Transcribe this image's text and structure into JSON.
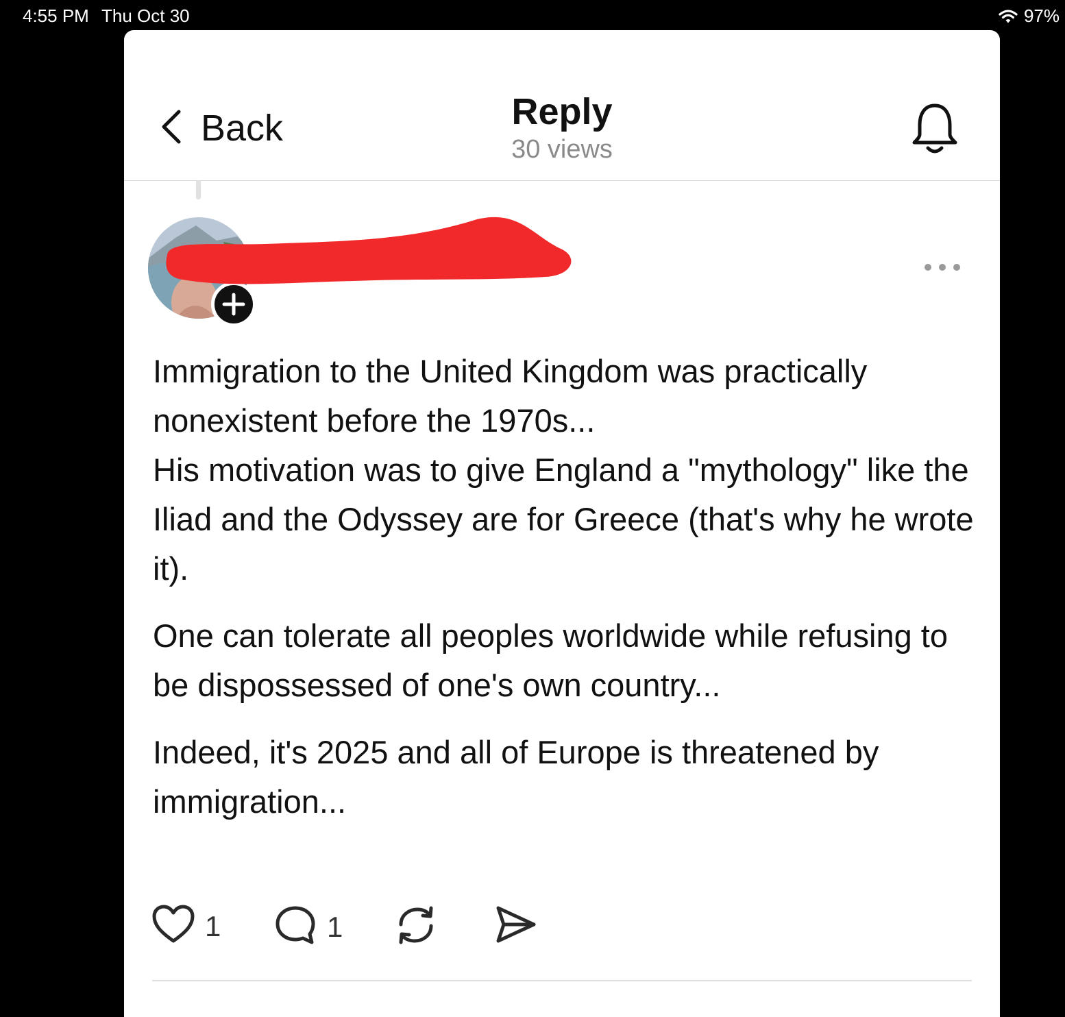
{
  "status_bar": {
    "time": "4:55 PM",
    "date": "Thu Oct 30",
    "battery": "97%",
    "icons": [
      "wifi-icon"
    ]
  },
  "header": {
    "back_label": "Back",
    "title": "Reply",
    "views": "30 views",
    "icons": [
      "chevron-left-icon",
      "bell-icon"
    ]
  },
  "post": {
    "paragraphs": [
      "Immigration to the United Kingdom was practically nonexistent before the 1970s...",
      "His motivation was to give England a \"mythology\" like the Iliad and the Odyssey are for Greece (that's why he wrote it).",
      "One can tolerate all peoples worldwide while refusing to be dispossessed of one's own country...",
      "Indeed, it's 2025 and all of Europe is threatened by immigration..."
    ],
    "icons": [
      "avatar",
      "plus-icon",
      "more-icon"
    ]
  },
  "actions": {
    "like_count": "1",
    "comment_count": "1",
    "icons": [
      "heart-icon",
      "comment-icon",
      "repost-icon",
      "share-icon"
    ]
  },
  "colors": {
    "redaction": "#f2292b",
    "background": "#000000",
    "sheet": "#ffffff",
    "muted_text": "#8a8a8a"
  }
}
